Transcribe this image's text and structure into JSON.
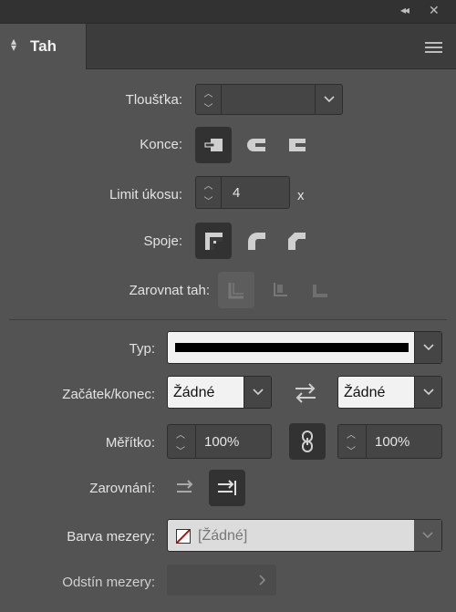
{
  "panel": {
    "collapse_glyph": "◂◂",
    "close_glyph": "✕",
    "tab_title": "Tah"
  },
  "stroke": {
    "weight_label": "Tloušťka:",
    "weight_value": "",
    "caps_label": "Konce:",
    "miter_label": "Limit úkosu:",
    "miter_value": "4",
    "miter_unit": "x",
    "joins_label": "Spoje:",
    "align_label": "Zarovnat tah:"
  },
  "style": {
    "type_label": "Typ:",
    "start_end_label": "Začátek/konec:",
    "start_value": "Žádné",
    "end_value": "Žádné",
    "scale_label": "Měřítko:",
    "scale_start": "100%",
    "scale_end": "100%",
    "alignment_label": "Zarovnání:",
    "gap_color_label": "Barva mezery:",
    "gap_color_value": "[Žádné]",
    "gap_tint_label": "Odstín mezery:",
    "gap_tint_value": ""
  },
  "colors": {
    "panel_bg": "#535353",
    "header_bg": "#323232",
    "selected_btn": "#323232",
    "line_preview": "#000000"
  }
}
